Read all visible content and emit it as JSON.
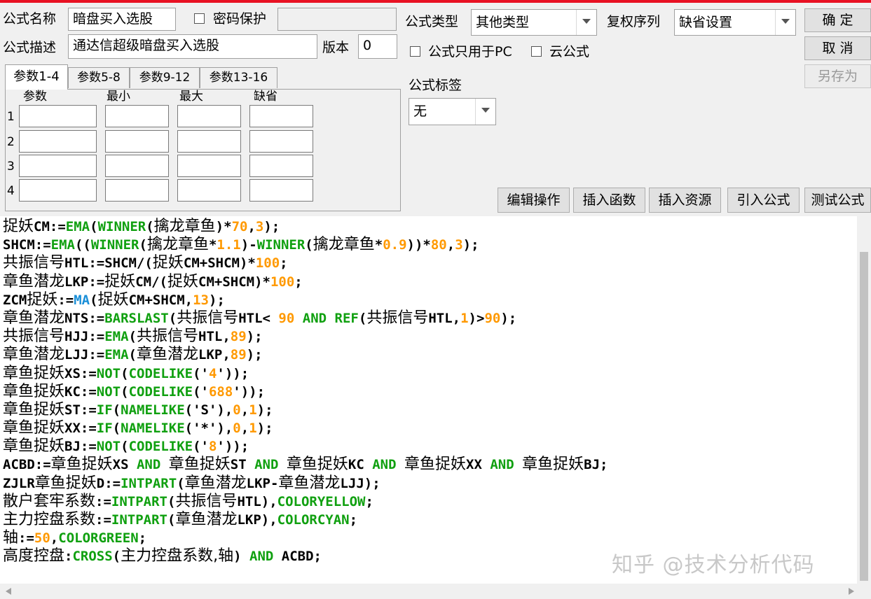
{
  "header": {
    "name_label": "公式名称",
    "name_value": "暗盘买入选股",
    "password_label": "密码保护",
    "password_checked": false,
    "desc_label": "公式描述",
    "desc_value": "通达信超级暗盘买入选股",
    "version_label": "版本",
    "version_value": "0",
    "type_label": "公式类型",
    "type_value": "其他类型",
    "rights_label": "复权序列",
    "rights_value": "缺省设置",
    "pc_only_label": "公式只用于PC",
    "pc_only_checked": false,
    "cloud_label": "云公式",
    "cloud_checked": false,
    "tag_label": "公式标签",
    "tag_value": "无"
  },
  "buttons": {
    "ok": "确 定",
    "cancel": "取 消",
    "save_as": "另存为",
    "edit_ops": "编辑操作",
    "insert_func": "插入函数",
    "insert_res": "插入资源",
    "import_formula": "引入公式",
    "test_formula": "测试公式"
  },
  "tabs": [
    "参数1-4",
    "参数5-8",
    "参数9-12",
    "参数13-16"
  ],
  "active_tab": 0,
  "params": {
    "columns": [
      "参数",
      "最小",
      "最大",
      "缺省"
    ],
    "rows": [
      "1",
      "2",
      "3",
      "4"
    ]
  },
  "code_lines": [
    [
      [
        "z",
        "捉妖"
      ],
      [
        "t",
        "CM:="
      ],
      [
        "f",
        "EMA"
      ],
      [
        "t",
        "("
      ],
      [
        "f",
        "WINNER"
      ],
      [
        "t",
        "("
      ],
      [
        "z",
        "擒龙章鱼"
      ],
      [
        "t",
        ")*"
      ],
      [
        "n",
        "70"
      ],
      [
        "t",
        ","
      ],
      [
        "n",
        "3"
      ],
      [
        "t",
        ");"
      ]
    ],
    [
      [
        "t",
        "SHCM:="
      ],
      [
        "f",
        "EMA"
      ],
      [
        "t",
        "(("
      ],
      [
        "f",
        "WINNER"
      ],
      [
        "t",
        "("
      ],
      [
        "z",
        "擒龙章鱼"
      ],
      [
        "t",
        "*"
      ],
      [
        "n",
        "1.1"
      ],
      [
        "t",
        ")-"
      ],
      [
        "f",
        "WINNER"
      ],
      [
        "t",
        "("
      ],
      [
        "z",
        "擒龙章鱼"
      ],
      [
        "t",
        "*"
      ],
      [
        "n",
        "0.9"
      ],
      [
        "t",
        "))*"
      ],
      [
        "n",
        "80"
      ],
      [
        "t",
        ","
      ],
      [
        "n",
        "3"
      ],
      [
        "t",
        ");"
      ]
    ],
    [
      [
        "z",
        "共振信号"
      ],
      [
        "t",
        "HTL:=SHCM/("
      ],
      [
        "z",
        "捉妖"
      ],
      [
        "t",
        "CM+SHCM)*"
      ],
      [
        "n",
        "100"
      ],
      [
        "t",
        ";"
      ]
    ],
    [
      [
        "z",
        "章鱼潜龙"
      ],
      [
        "t",
        "LKP:="
      ],
      [
        "z",
        "捉妖"
      ],
      [
        "t",
        "CM/("
      ],
      [
        "z",
        "捉妖"
      ],
      [
        "t",
        "CM+SHCM)*"
      ],
      [
        "n",
        "100"
      ],
      [
        "t",
        ";"
      ]
    ],
    [
      [
        "t",
        "ZCM"
      ],
      [
        "z",
        "捉妖"
      ],
      [
        "t",
        ":="
      ],
      [
        "m",
        "MA"
      ],
      [
        "t",
        "("
      ],
      [
        "z",
        "捉妖"
      ],
      [
        "t",
        "CM+SHCM,"
      ],
      [
        "n",
        "13"
      ],
      [
        "t",
        ");"
      ]
    ],
    [
      [
        "z",
        "章鱼潜龙"
      ],
      [
        "t",
        "NTS:="
      ],
      [
        "f",
        "BARSLAST"
      ],
      [
        "t",
        "("
      ],
      [
        "z",
        "共振信号"
      ],
      [
        "t",
        "HTL< "
      ],
      [
        "n",
        "90"
      ],
      [
        "t",
        " "
      ],
      [
        "f",
        "AND"
      ],
      [
        "t",
        " "
      ],
      [
        "f",
        "REF"
      ],
      [
        "t",
        "("
      ],
      [
        "z",
        "共振信号"
      ],
      [
        "t",
        "HTL,"
      ],
      [
        "n",
        "1"
      ],
      [
        "t",
        ")>"
      ],
      [
        "n",
        "90"
      ],
      [
        "t",
        ");"
      ]
    ],
    [
      [
        "z",
        "共振信号"
      ],
      [
        "t",
        "HJJ:="
      ],
      [
        "f",
        "EMA"
      ],
      [
        "t",
        "("
      ],
      [
        "z",
        "共振信号"
      ],
      [
        "t",
        "HTL,"
      ],
      [
        "n",
        "89"
      ],
      [
        "t",
        ");"
      ]
    ],
    [
      [
        "z",
        "章鱼潜龙"
      ],
      [
        "t",
        "LJJ:="
      ],
      [
        "f",
        "EMA"
      ],
      [
        "t",
        "("
      ],
      [
        "z",
        "章鱼潜龙"
      ],
      [
        "t",
        "LKP,"
      ],
      [
        "n",
        "89"
      ],
      [
        "t",
        ");"
      ]
    ],
    [
      [
        "z",
        "章鱼捉妖"
      ],
      [
        "t",
        "XS:="
      ],
      [
        "f",
        "NOT"
      ],
      [
        "t",
        "("
      ],
      [
        "f",
        "CODELIKE"
      ],
      [
        "t",
        "('"
      ],
      [
        "n",
        "4"
      ],
      [
        "t",
        "'));"
      ]
    ],
    [
      [
        "z",
        "章鱼捉妖"
      ],
      [
        "t",
        "KC:="
      ],
      [
        "f",
        "NOT"
      ],
      [
        "t",
        "("
      ],
      [
        "f",
        "CODELIKE"
      ],
      [
        "t",
        "('"
      ],
      [
        "n",
        "688"
      ],
      [
        "t",
        "'));"
      ]
    ],
    [
      [
        "z",
        "章鱼捉妖"
      ],
      [
        "t",
        "ST:="
      ],
      [
        "f",
        "IF"
      ],
      [
        "t",
        "("
      ],
      [
        "f",
        "NAMELIKE"
      ],
      [
        "t",
        "('S'),"
      ],
      [
        "n",
        "0"
      ],
      [
        "t",
        ","
      ],
      [
        "n",
        "1"
      ],
      [
        "t",
        ");"
      ]
    ],
    [
      [
        "z",
        "章鱼捉妖"
      ],
      [
        "t",
        "XX:="
      ],
      [
        "f",
        "IF"
      ],
      [
        "t",
        "("
      ],
      [
        "f",
        "NAMELIKE"
      ],
      [
        "t",
        "('*'),"
      ],
      [
        "n",
        "0"
      ],
      [
        "t",
        ","
      ],
      [
        "n",
        "1"
      ],
      [
        "t",
        ");"
      ]
    ],
    [
      [
        "z",
        "章鱼捉妖"
      ],
      [
        "t",
        "BJ:="
      ],
      [
        "f",
        "NOT"
      ],
      [
        "t",
        "("
      ],
      [
        "f",
        "CODELIKE"
      ],
      [
        "t",
        "('"
      ],
      [
        "n",
        "8"
      ],
      [
        "t",
        "'));"
      ]
    ],
    [
      [
        "t",
        "ACBD:="
      ],
      [
        "z",
        "章鱼捉妖"
      ],
      [
        "t",
        "XS "
      ],
      [
        "f",
        "AND"
      ],
      [
        "t",
        " "
      ],
      [
        "z",
        "章鱼捉妖"
      ],
      [
        "t",
        "ST "
      ],
      [
        "f",
        "AND"
      ],
      [
        "t",
        " "
      ],
      [
        "z",
        "章鱼捉妖"
      ],
      [
        "t",
        "KC "
      ],
      [
        "f",
        "AND"
      ],
      [
        "t",
        " "
      ],
      [
        "z",
        "章鱼捉妖"
      ],
      [
        "t",
        "XX "
      ],
      [
        "f",
        "AND"
      ],
      [
        "t",
        " "
      ],
      [
        "z",
        "章鱼捉妖"
      ],
      [
        "t",
        "BJ;"
      ]
    ],
    [
      [
        "t",
        "ZJLR"
      ],
      [
        "z",
        "章鱼捉妖"
      ],
      [
        "t",
        "D:="
      ],
      [
        "f",
        "INTPART"
      ],
      [
        "t",
        "("
      ],
      [
        "z",
        "章鱼潜龙"
      ],
      [
        "t",
        "LKP-"
      ],
      [
        "z",
        "章鱼潜龙"
      ],
      [
        "t",
        "LJJ);"
      ]
    ],
    [
      [
        "z",
        "散户套牢系数"
      ],
      [
        "t",
        ":="
      ],
      [
        "f",
        "INTPART"
      ],
      [
        "t",
        "("
      ],
      [
        "z",
        "共振信号"
      ],
      [
        "t",
        "HTL),"
      ],
      [
        "f",
        "COLORYELLOW"
      ],
      [
        "t",
        ";"
      ]
    ],
    [
      [
        "z",
        "主力控盘系数"
      ],
      [
        "t",
        ":="
      ],
      [
        "f",
        "INTPART"
      ],
      [
        "t",
        "("
      ],
      [
        "z",
        "章鱼潜龙"
      ],
      [
        "t",
        "LKP),"
      ],
      [
        "f",
        "COLORCYAN"
      ],
      [
        "t",
        ";"
      ]
    ],
    [
      [
        "z",
        "轴"
      ],
      [
        "t",
        ":="
      ],
      [
        "n",
        "50"
      ],
      [
        "t",
        ","
      ],
      [
        "f",
        "COLORGREEN"
      ],
      [
        "t",
        ";"
      ]
    ],
    [
      [
        "z",
        "高度控盘"
      ],
      [
        "t",
        ":"
      ],
      [
        "f",
        "CROSS"
      ],
      [
        "t",
        "("
      ],
      [
        "z",
        "主力控盘系数,轴"
      ],
      [
        "t",
        ") "
      ],
      [
        "f",
        "AND"
      ],
      [
        "t",
        " ACBD;"
      ]
    ]
  ],
  "watermark": "知乎 @技术分析代码"
}
